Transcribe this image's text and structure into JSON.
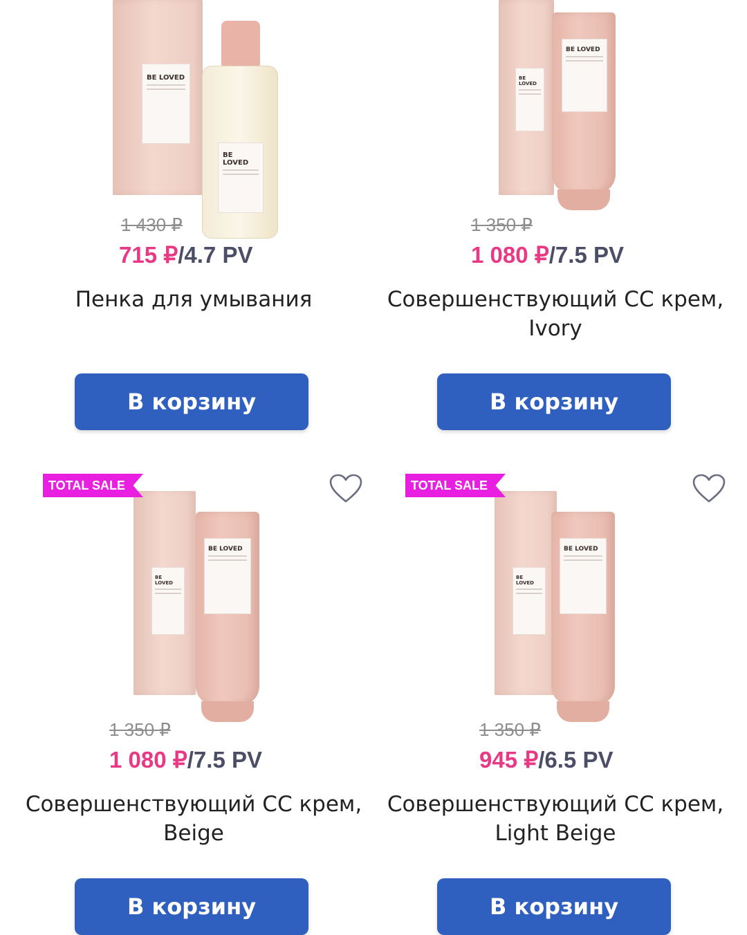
{
  "currency_symbol": "₽",
  "colors": {
    "accent_price": "#e83a84",
    "pv_text": "#4b4e66",
    "button": "#2f5fbf",
    "sale_badge": "#e81ee0"
  },
  "products": [
    {
      "old_price": "1 430 ₽",
      "price": "715 ₽",
      "pv": "/4.7 PV",
      "title_lines": [
        "Пенка для умывания"
      ],
      "button_label": "В корзину",
      "brand": "BE LOVED"
    },
    {
      "old_price": "1 350 ₽",
      "price": "1 080 ₽",
      "pv": "/7.5 PV",
      "title_lines": [
        "Совершенствующий СС крем,",
        "Ivory"
      ],
      "button_label": "В корзину",
      "brand": "BE LOVED"
    },
    {
      "badge": "TOTAL SALE",
      "favorite_icon": "heart-outline-icon",
      "old_price": "1 350 ₽",
      "price": "1 080 ₽",
      "pv": "/7.5 PV",
      "title_lines": [
        "Совершенствующий СС крем,",
        "Beige"
      ],
      "button_label": "В корзину",
      "brand": "BE LOVED"
    },
    {
      "badge": "TOTAL SALE",
      "favorite_icon": "heart-outline-icon",
      "old_price": "1 350 ₽",
      "price": "945 ₽",
      "pv": "/6.5 PV",
      "title_lines": [
        "Совершенствующий СС крем,",
        "Light Beige"
      ],
      "button_label": "В корзину",
      "brand": "BE LOVED"
    }
  ]
}
